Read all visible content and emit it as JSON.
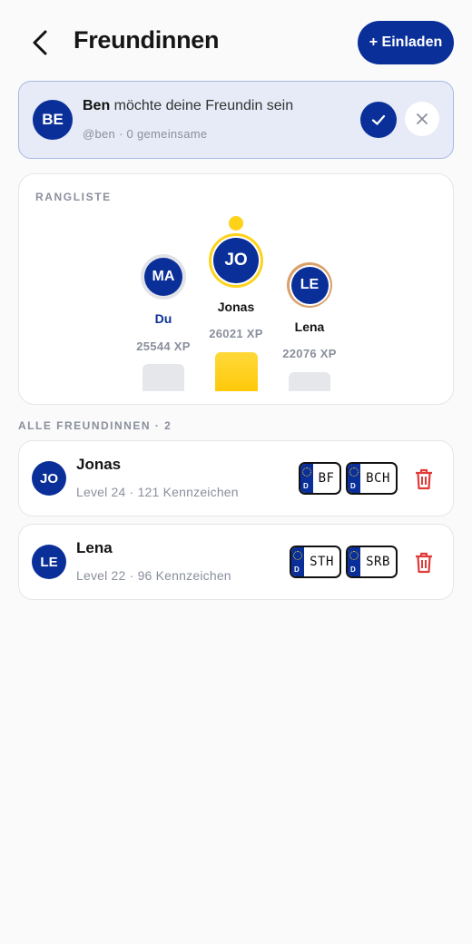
{
  "header": {
    "title": "Freundinnen",
    "invite_label": "+ Einladen",
    "back_icon": "chevron-left-icon"
  },
  "request": {
    "initials": "BE",
    "name": "Ben",
    "message": " möchte deine Freundin sein",
    "sub": "@ben · 0 gemeinsame",
    "accept_icon": "check-icon",
    "decline_icon": "close-icon"
  },
  "ranking": {
    "heading": "RANGLISTE",
    "podium": [
      {
        "place": 2,
        "initials": "MA",
        "name": "Du",
        "xp": "25544 XP",
        "ring": "silver",
        "highlight": true
      },
      {
        "place": 1,
        "initials": "JO",
        "name": "Jonas",
        "xp": "26021 XP",
        "ring": "gold",
        "highlight": false
      },
      {
        "place": 3,
        "initials": "LE",
        "name": "Lena",
        "xp": "22076 XP",
        "ring": "bronze",
        "highlight": false
      }
    ]
  },
  "friends_section": {
    "title": "ALLE FREUNDINNEN · 2"
  },
  "friends": [
    {
      "initials": "JO",
      "name": "Jonas",
      "sub": "Level 24 · 121 Kennzeichen",
      "plates": [
        "BF",
        "BCH"
      ]
    },
    {
      "initials": "LE",
      "name": "Lena",
      "sub": "Level 22 · 96 Kennzeichen",
      "plates": [
        "STH",
        "SRB"
      ]
    }
  ],
  "colors": {
    "primary": "#0a2f99",
    "request_bg": "#e6ebf7",
    "gold": "#ffd21a",
    "silver": "#e2e3e8",
    "bronze": "#d9a06b",
    "danger": "#e03b3b"
  }
}
